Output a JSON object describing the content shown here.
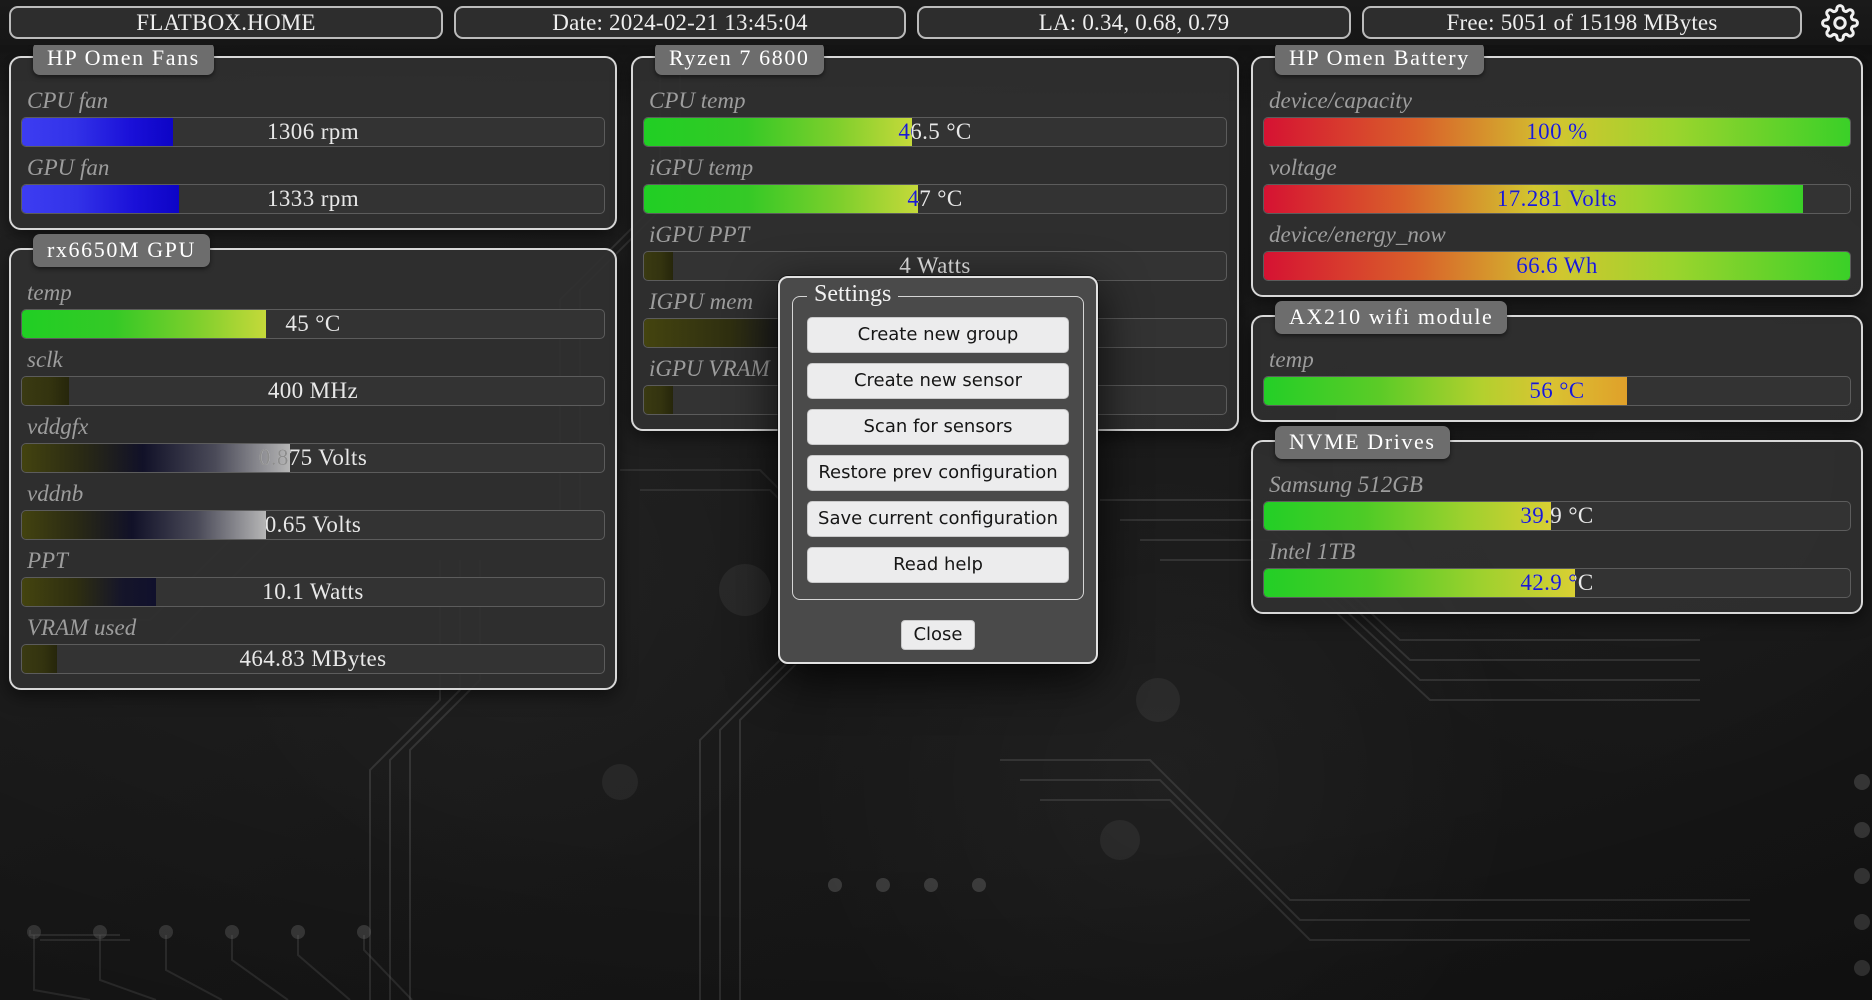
{
  "header": {
    "hostname": "FLATBOX.HOME",
    "date": "Date: 2024-02-21 13:45:04",
    "load_average": "LA: 0.34, 0.68, 0.79",
    "memory": "Free: 5051 of 15198 MBytes",
    "settings_icon": "gear-icon"
  },
  "groups": [
    {
      "id": "hp-omen-fans",
      "title": "HP  Omen  Fans",
      "column": "left",
      "sensors": [
        {
          "label": "CPU fan",
          "value": "1306",
          "unit": "rpm",
          "text": "1306  rpm",
          "fill_pct": 26,
          "gradient": "blue"
        },
        {
          "label": "GPU fan",
          "value": "1333",
          "unit": "rpm",
          "text": "1333  rpm",
          "fill_pct": 27,
          "gradient": "blue"
        }
      ]
    },
    {
      "id": "rx6650m-gpu",
      "title": "rx6650M  GPU",
      "column": "left",
      "sensors": [
        {
          "label": "temp",
          "value": "45",
          "unit": "°C",
          "text": "45  °C",
          "fill_pct": 42,
          "gradient": "green"
        },
        {
          "label": "sclk",
          "value": "400",
          "unit": "MHz",
          "text": "400  MHz",
          "fill_pct": 8,
          "gradient": "olive"
        },
        {
          "label": "vddgfx",
          "value": "0.875",
          "unit": "Volts",
          "text": "0.875  Volts",
          "fill_pct": 46,
          "gradient": "dusk"
        },
        {
          "label": "vddnb",
          "value": "0.65",
          "unit": "Volts",
          "text": "0.65  Volts",
          "fill_pct": 42,
          "gradient": "dusk"
        },
        {
          "label": "PPT",
          "value": "10.1",
          "unit": "Watts",
          "text": "10.1  Watts",
          "fill_pct": 23,
          "gradient": "oliveblue"
        },
        {
          "label": "VRAM used",
          "value": "464.83",
          "unit": "MBytes",
          "text": "464.83  MBytes",
          "fill_pct": 6,
          "gradient": "olive"
        }
      ]
    },
    {
      "id": "ryzen-7-6800",
      "title": "Ryzen  7  6800",
      "column": "center",
      "sensors": [
        {
          "label": "CPU temp",
          "value": "46.5",
          "unit": "°C",
          "text": "46.5  °C",
          "fill_pct": 46,
          "gradient": "green"
        },
        {
          "label": "iGPU temp",
          "value": "47",
          "unit": "°C",
          "text": "47  °C",
          "fill_pct": 47,
          "gradient": "green"
        },
        {
          "label": "iGPU PPT",
          "value": "4",
          "unit": "Watts",
          "text": "4  Watts",
          "fill_pct": 5,
          "gradient": "olive"
        },
        {
          "label": "IGPU mem",
          "value": "",
          "unit": "",
          "text": "",
          "fill_pct": 38,
          "gradient": "oliveblue"
        },
        {
          "label": "iGPU VRAM",
          "value": "",
          "unit": "",
          "text": "",
          "fill_pct": 5,
          "gradient": "olive"
        }
      ]
    },
    {
      "id": "hp-omen-battery",
      "title": "HP  Omen  Battery",
      "column": "right",
      "sensors": [
        {
          "label": "device/capacity",
          "value": "100",
          "unit": "%",
          "text": "100  %",
          "fill_pct": 100,
          "gradient": "redgreen"
        },
        {
          "label": "voltage",
          "value": "17.281",
          "unit": "Volts",
          "text": "17.281  Volts",
          "fill_pct": 92,
          "gradient": "redgreen"
        },
        {
          "label": "device/energy_now",
          "value": "66.6",
          "unit": "Wh",
          "text": "66.6  Wh",
          "fill_pct": 100,
          "gradient": "redgreen"
        }
      ]
    },
    {
      "id": "ax210-wifi-module",
      "title": "AX210  wifi  module",
      "column": "right",
      "sensors": [
        {
          "label": "temp",
          "value": "56",
          "unit": "°C",
          "text": "56  °C",
          "fill_pct": 62,
          "gradient": "greenorange"
        }
      ]
    },
    {
      "id": "nvme-drives",
      "title": "NVME  Drives",
      "column": "right",
      "sensors": [
        {
          "label": "Samsung 512GB",
          "value": "39.9",
          "unit": "°C",
          "text": "39.9  °C",
          "fill_pct": 49,
          "gradient": "greenyellow"
        },
        {
          "label": "Intel 1TB",
          "value": "42.9",
          "unit": "°C",
          "text": "42.9  °C",
          "fill_pct": 53,
          "gradient": "greenyellow"
        }
      ]
    }
  ],
  "dialog": {
    "legend": "Settings",
    "buttons": [
      "Create new group",
      "Create new sensor",
      "Scan for sensors",
      "Restore prev configuration",
      "Save current configuration",
      "Read help"
    ],
    "close_label": "Close"
  },
  "colors": {
    "panel_bg": "#2f2f2f",
    "panel_border": "#d8d8d8",
    "title_badge_bg": "#6d6d6d",
    "label_text": "#9d9d9d",
    "value_text": "#e8e8e8",
    "value_text_over_bar": "#1a1acd",
    "dialog_bg": "#4a4a4a",
    "dialog_button_bg": "#ececed",
    "background": "#1b1b1b"
  }
}
